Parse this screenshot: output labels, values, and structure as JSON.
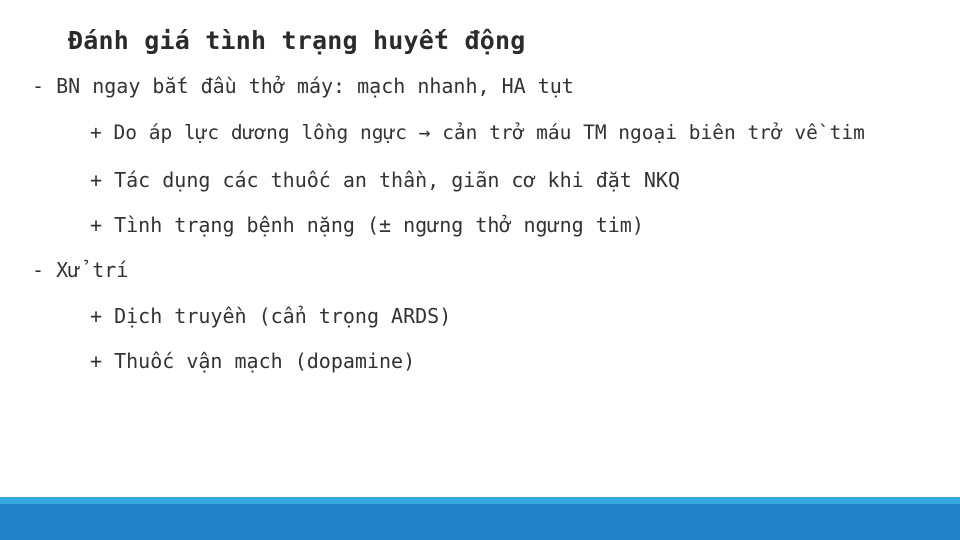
{
  "slide": {
    "title": "Đánh giá tình trạng huyết động",
    "lines": [
      "- BN ngay bắt đầu thở máy: mạch nhanh, HA tụt",
      "+ Do áp lực dương lồng ngực → cản trở máu TM ngoại biên trở về tim",
      "+ Tác dụng các thuốc an thần, giãn cơ khi đặt NKQ",
      "+ Tình trạng bệnh nặng (± ngưng thở ngưng tim)",
      "- Xử trí",
      "+ Dịch truyền (cẩn trọng ARDS)",
      "+ Thuốc vận mạch (dopamine)"
    ]
  },
  "colors": {
    "text": "#2b2b2b",
    "footer_light": "#36a8dd",
    "footer_dark": "#2381c8"
  }
}
